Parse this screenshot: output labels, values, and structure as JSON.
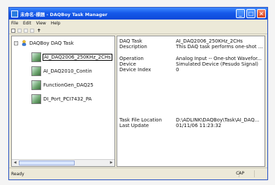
{
  "window": {
    "title": "未命名-標題 - DAQBoy Task Manager"
  },
  "menu": {
    "items": [
      "File",
      "Edit",
      "View",
      "Help"
    ]
  },
  "tree": {
    "root_label": "DAQBoy DAQ Task",
    "children": [
      "AI_DAQ2006_250KHz_2CHs",
      "AI_DAQ2010_Contin",
      "FunctionGen_DAQ25",
      "DI_Port_PCI7432_PA"
    ]
  },
  "properties": [
    {
      "key": "DAQ Task",
      "value": "AI_DAQ2006_250KHz_2CHs"
    },
    {
      "key": "Description",
      "value": "This DAQ task performs one-shot ..."
    },
    {
      "key": "Operation",
      "value": "Analog Input -- One-shot Wavefor..."
    },
    {
      "key": "Device",
      "value": "Simulated Device (Pesudo Signal)"
    },
    {
      "key": "Device Index",
      "value": "0"
    },
    {
      "key": "Task File Location",
      "value": "D:\\ADLINK\\DAQBoy\\Task\\AI_DAQ..."
    },
    {
      "key": "Last Update",
      "value": "01/11/06 11:23:32"
    }
  ],
  "status": {
    "left": "Ready",
    "right": "CAP"
  },
  "colors": {
    "titlebar": "#1559ea",
    "selection_outline": "#000000",
    "tree_bg": "#ffffff"
  },
  "icons": [
    "minimize-icon",
    "maximize-icon",
    "close-icon",
    "expand-icon",
    "root-user-icon",
    "task-icon",
    "new-doc-icon",
    "open-icon",
    "save-icon",
    "pin-icon"
  ]
}
